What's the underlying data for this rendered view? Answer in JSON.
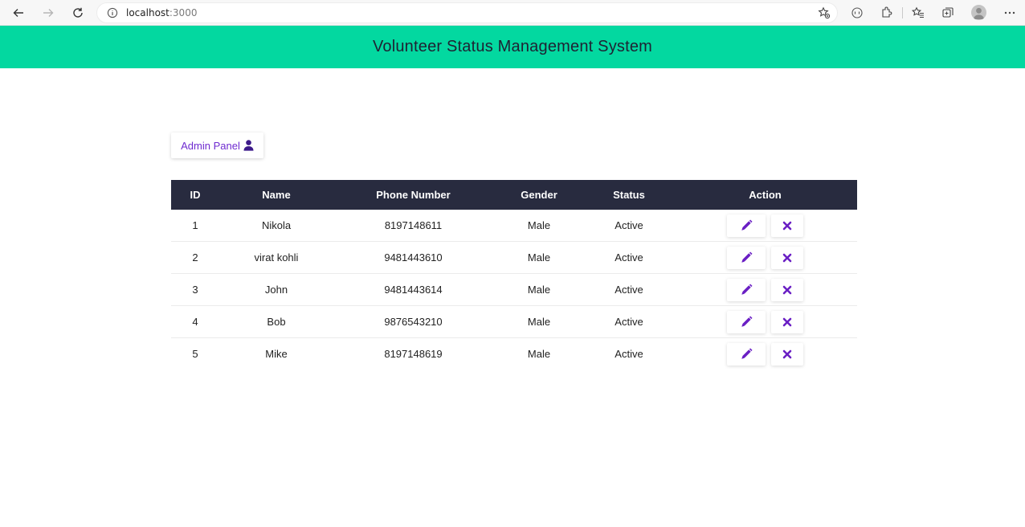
{
  "browser": {
    "url_host": "localhost",
    "url_port": ":3000"
  },
  "app": {
    "title": "Volunteer Status Management System"
  },
  "admin_button": {
    "label": "Admin Panel"
  },
  "table": {
    "headers": [
      "ID",
      "Name",
      "Phone Number",
      "Gender",
      "Status",
      "Action"
    ],
    "rows": [
      {
        "id": "1",
        "name": "Nikola",
        "phone": "8197148611",
        "gender": "Male",
        "status": "Active"
      },
      {
        "id": "2",
        "name": "virat kohli",
        "phone": "9481443610",
        "gender": "Male",
        "status": "Active"
      },
      {
        "id": "3",
        "name": "John",
        "phone": "9481443614",
        "gender": "Male",
        "status": "Active"
      },
      {
        "id": "4",
        "name": "Bob",
        "phone": "9876543210",
        "gender": "Male",
        "status": "Active"
      },
      {
        "id": "5",
        "name": "Mike",
        "phone": "8197148619",
        "gender": "Male",
        "status": "Active"
      }
    ]
  },
  "colors": {
    "header_bg": "#03d8a0",
    "table_header_bg": "#282b3f",
    "accent": "#6f2bd0"
  },
  "icons": {
    "edit": "pencil-icon",
    "delete": "close-icon",
    "admin": "user-icon"
  }
}
